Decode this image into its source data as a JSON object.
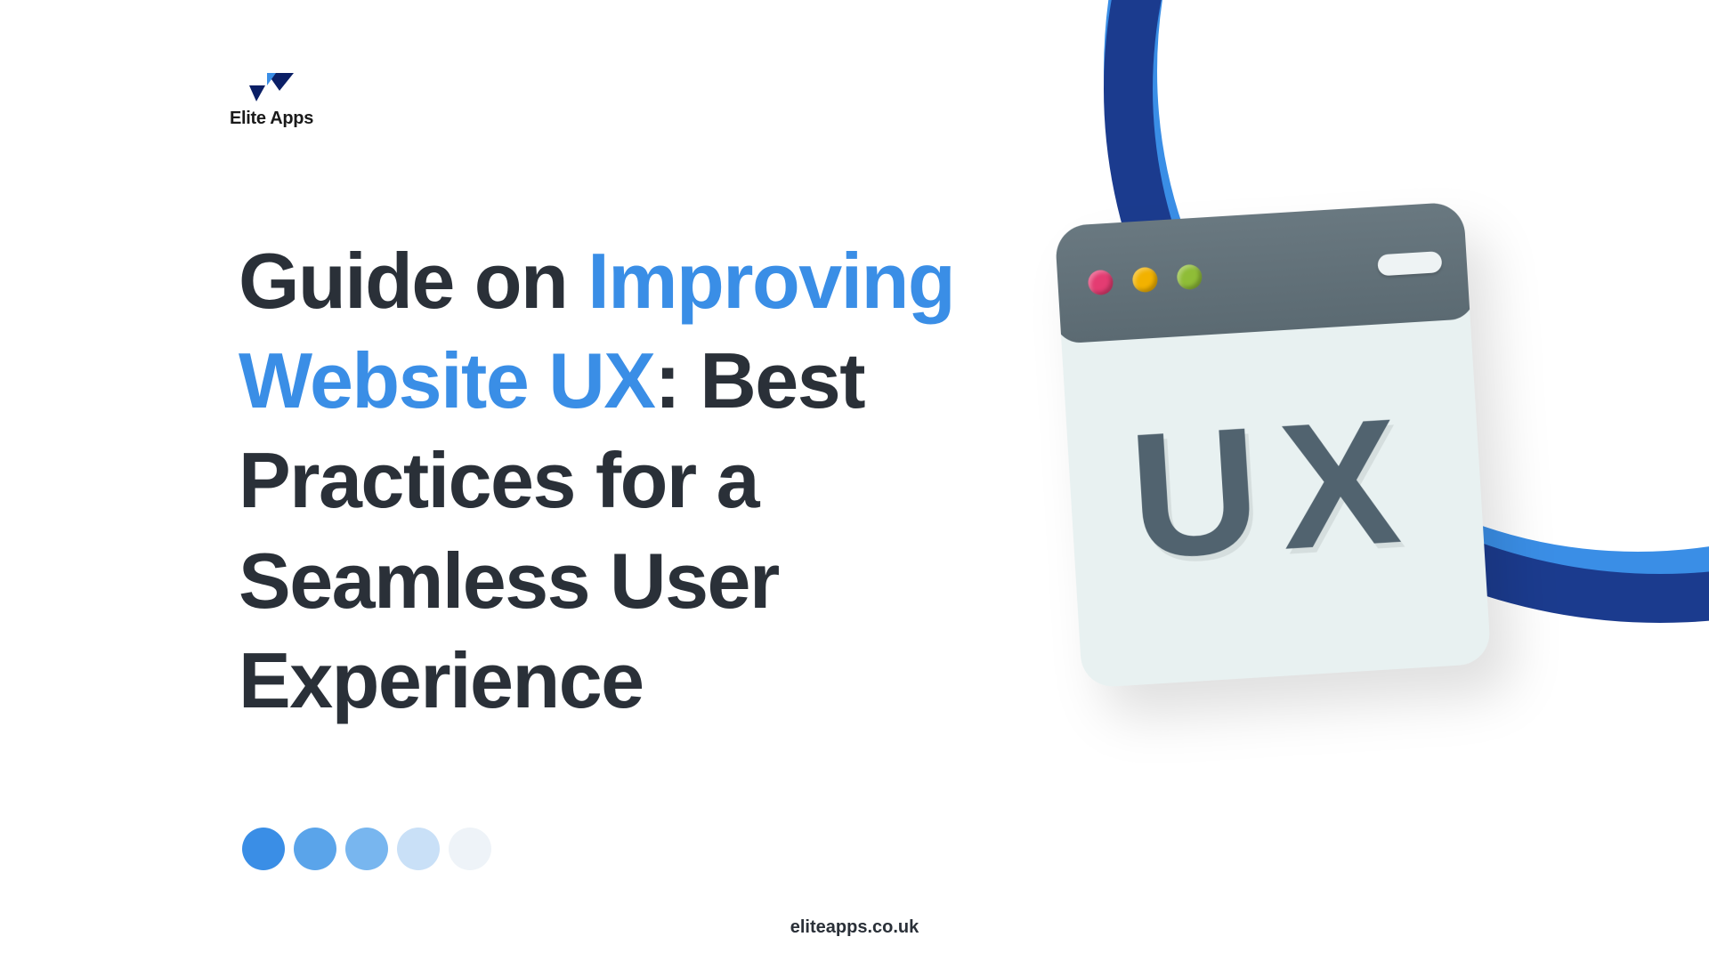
{
  "brand": {
    "name": "Elite Apps"
  },
  "title": {
    "prefix": "Guide on ",
    "accent": "Improving Website UX",
    "suffix": ": Best Practices for a Seamless User Experience"
  },
  "illustration": {
    "letters": "UX"
  },
  "dots": {
    "colors": [
      "#3a8ee6",
      "#5aa4ea",
      "#78b6ef",
      "#c9e0f7",
      "#eef3f8"
    ]
  },
  "footer": {
    "url": "eliteapps.co.uk"
  }
}
